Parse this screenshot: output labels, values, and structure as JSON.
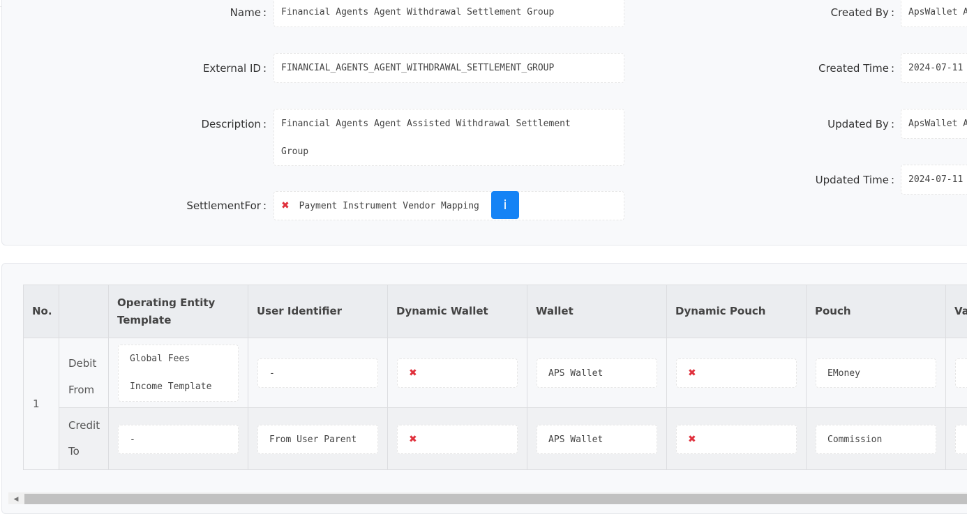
{
  "details": {
    "name_label": "Name",
    "name_value": "Financial Agents Agent Withdrawal Settlement Group",
    "external_id_label": "External ID",
    "external_id_value": "FINANCIAL_AGENTS_AGENT_WITHDRAWAL_SETTLEMENT_GROUP",
    "description_label": "Description",
    "description_line1": "Financial Agents Agent Assisted Withdrawal Settlement",
    "description_line2": "Group",
    "settlement_for_label": "SettlementFor",
    "settlement_for_value": "Payment Instrument Vendor Mapping",
    "info_button": "i",
    "created_by_label": "Created By",
    "created_by_value": "ApsWallet A",
    "created_time_label": "Created Time",
    "created_time_value": "2024-07-11",
    "updated_by_label": "Updated By",
    "updated_by_value": "ApsWallet A",
    "updated_time_label": "Updated Time",
    "updated_time_value": "2024-07-11",
    "colon": ":"
  },
  "table": {
    "headers": [
      "No.",
      "",
      "Operating Entity Template",
      "User Identifier",
      "Dynamic Wallet",
      "Wallet",
      "Dynamic Pouch",
      "Pouch",
      "Va"
    ],
    "row_number": "1",
    "rows": [
      {
        "side": "Debit From",
        "operating_entity_template": "Global Fees Income Template",
        "user_identifier": "-",
        "dynamic_wallet": "✖",
        "wallet": "APS Wallet",
        "dynamic_pouch": "✖",
        "pouch": "EMoney"
      },
      {
        "side": "Credit To",
        "operating_entity_template": "-",
        "user_identifier": "From User Parent",
        "dynamic_wallet": "✖",
        "wallet": "APS Wallet",
        "dynamic_pouch": "✖",
        "pouch": "Commission"
      }
    ]
  },
  "colors": {
    "accent": "#1583f5",
    "false_mark": "#e0303c"
  }
}
